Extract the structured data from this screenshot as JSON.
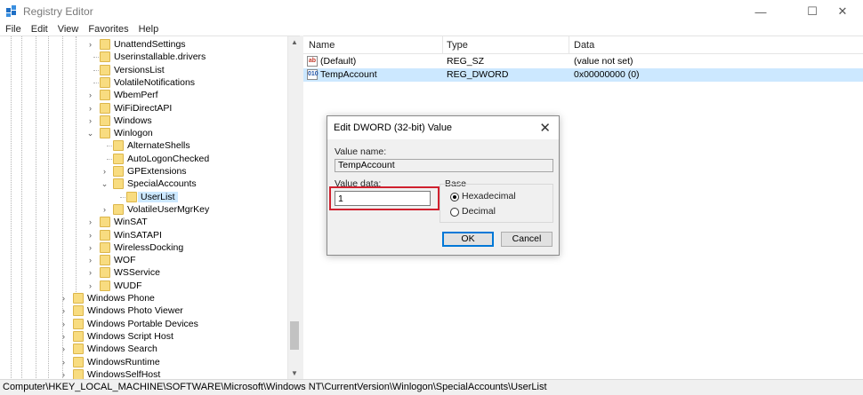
{
  "window": {
    "title": "Registry Editor",
    "controls": {
      "minimize": "—",
      "maximize": "☐",
      "close": "✕"
    }
  },
  "menu": [
    "File",
    "Edit",
    "View",
    "Favorites",
    "Help"
  ],
  "tree": {
    "items": [
      {
        "label": "UnattendSettings",
        "expander": ">",
        "level": 0
      },
      {
        "label": "Userinstallable.drivers",
        "expander": "",
        "level": 0
      },
      {
        "label": "VersionsList",
        "expander": "",
        "level": 0
      },
      {
        "label": "VolatileNotifications",
        "expander": "",
        "level": 0
      },
      {
        "label": "WbemPerf",
        "expander": ">",
        "level": 0
      },
      {
        "label": "WiFiDirectAPI",
        "expander": ">",
        "level": 0
      },
      {
        "label": "Windows",
        "expander": ">",
        "level": 0
      },
      {
        "label": "Winlogon",
        "expander": "v",
        "level": 0
      },
      {
        "label": "AlternateShells",
        "expander": "",
        "level": 1
      },
      {
        "label": "AutoLogonChecked",
        "expander": "",
        "level": 1
      },
      {
        "label": "GPExtensions",
        "expander": ">",
        "level": 1
      },
      {
        "label": "SpecialAccounts",
        "expander": "v",
        "level": 1
      },
      {
        "label": "UserList",
        "expander": "",
        "level": 2,
        "selected": true
      },
      {
        "label": "VolatileUserMgrKey",
        "expander": ">",
        "level": 1
      },
      {
        "label": "WinSAT",
        "expander": ">",
        "level": 0
      },
      {
        "label": "WinSATAPI",
        "expander": ">",
        "level": 0
      },
      {
        "label": "WirelessDocking",
        "expander": ">",
        "level": 0
      },
      {
        "label": "WOF",
        "expander": ">",
        "level": 0
      },
      {
        "label": "WSService",
        "expander": ">",
        "level": 0
      },
      {
        "label": "WUDF",
        "expander": ">",
        "level": 0
      },
      {
        "label": "Windows Phone",
        "expander": ">",
        "level": -1
      },
      {
        "label": "Windows Photo Viewer",
        "expander": ">",
        "level": -1
      },
      {
        "label": "Windows Portable Devices",
        "expander": ">",
        "level": -1
      },
      {
        "label": "Windows Script Host",
        "expander": ">",
        "level": -1
      },
      {
        "label": "Windows Search",
        "expander": ">",
        "level": -1
      },
      {
        "label": "WindowsRuntime",
        "expander": ">",
        "level": -1
      },
      {
        "label": "WindowsSelfHost",
        "expander": ">",
        "level": -1
      }
    ]
  },
  "list": {
    "columns": [
      "Name",
      "Type",
      "Data"
    ],
    "rows": [
      {
        "icon": "string-value-icon",
        "icon_text": "ab",
        "name": "(Default)",
        "type": "REG_SZ",
        "data": "(value not set)",
        "selected": false
      },
      {
        "icon": "dword-value-icon",
        "icon_text": "010",
        "name": "TempAccount",
        "type": "REG_DWORD",
        "data": "0x00000000 (0)",
        "selected": true
      }
    ]
  },
  "status_path": "Computer\\HKEY_LOCAL_MACHINE\\SOFTWARE\\Microsoft\\Windows NT\\CurrentVersion\\Winlogon\\SpecialAccounts\\UserList",
  "dialog": {
    "title": "Edit DWORD (32-bit) Value",
    "close": "✕",
    "value_name_label": "Value name:",
    "value_name": "TempAccount",
    "value_data_label": "Value data:",
    "value_data": "1",
    "base_label": "Base",
    "base_options": [
      {
        "label": "Hexadecimal",
        "selected": true
      },
      {
        "label": "Decimal",
        "selected": false
      }
    ],
    "ok_label": "OK",
    "cancel_label": "Cancel"
  },
  "colors": {
    "selection": "#cce8ff",
    "folder": "#f8dc80",
    "highlight_border": "#d0202e",
    "default_button_border": "#0078d7"
  }
}
